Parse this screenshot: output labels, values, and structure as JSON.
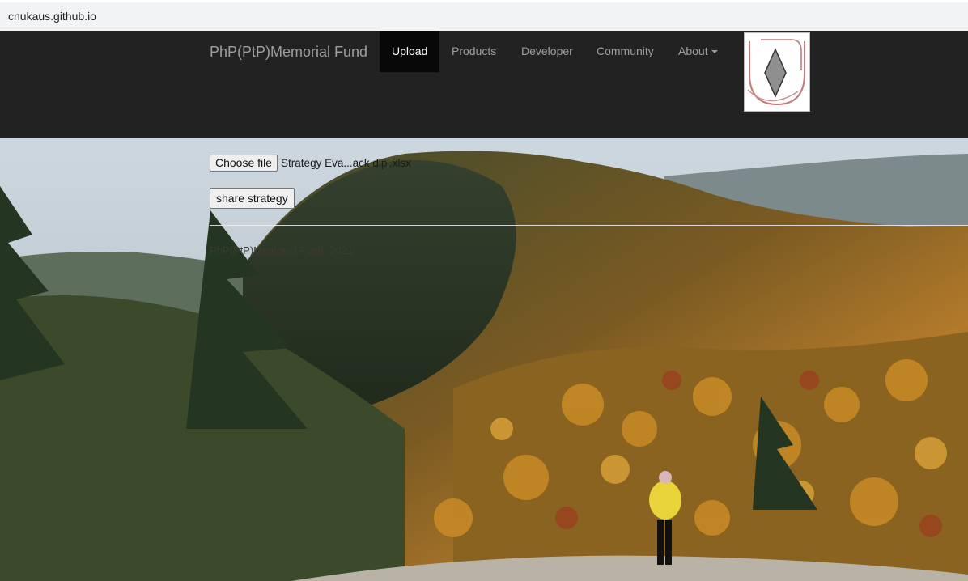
{
  "browser": {
    "url": "cnukaus.github.io"
  },
  "navbar": {
    "brand": "PhP(PtP)Memorial Fund",
    "items": [
      {
        "label": "Upload",
        "active": true
      },
      {
        "label": "Products",
        "active": false
      },
      {
        "label": "Developer",
        "active": false
      },
      {
        "label": "Community",
        "active": false
      },
      {
        "label": "About",
        "active": false,
        "dropdown": true
      }
    ],
    "logo": "diamond-logo-icon"
  },
  "upload": {
    "choose_label": "Choose file",
    "file_name": "Strategy Eva...ack dip'.xlsx",
    "share_label": "share strategy"
  },
  "footer": {
    "text": "PhP(PtP)Memorial Fund, 2021"
  },
  "colors": {
    "navbar_bg": "#222222",
    "active_bg": "#080808",
    "nav_text": "#9d9d9d"
  }
}
